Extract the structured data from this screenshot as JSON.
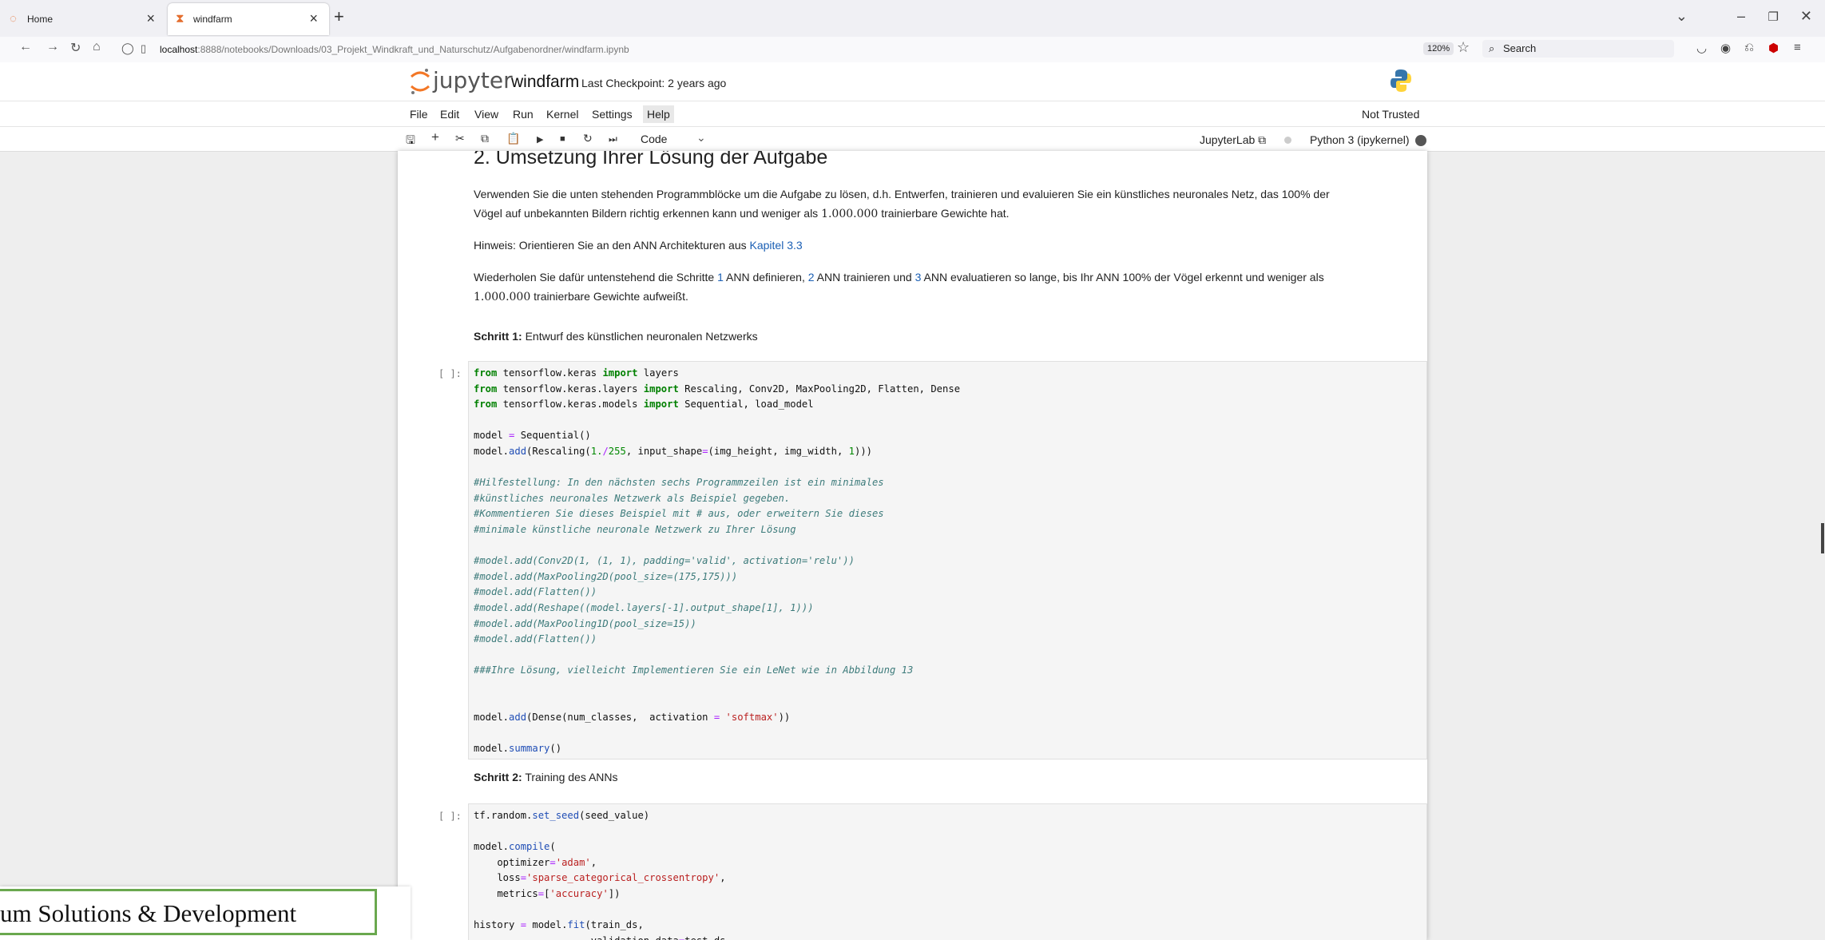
{
  "browser": {
    "tabs": [
      {
        "title": "Home"
      },
      {
        "title": "windfarm"
      }
    ],
    "url_host": "localhost",
    "url_path": ":8888/notebooks/Downloads/03_Projekt_Windkraft_und_Naturschutz/Aufgabenordner/windfarm.ipynb",
    "zoom": "120%",
    "search_placeholder": "Search"
  },
  "jupyter": {
    "logo_text": "jupyter",
    "notebook_name": "windfarm",
    "checkpoint": "Last Checkpoint: 2 years ago",
    "menu": [
      "File",
      "Edit",
      "View",
      "Run",
      "Kernel",
      "Settings",
      "Help"
    ],
    "trust": "Not Trusted",
    "cell_type": "Code",
    "jupyterlab_label": "JupyterLab",
    "kernel_name": "Python 3 (ipykernel)"
  },
  "notebook": {
    "heading": "2. Umsetzung Ihrer Lösung der Aufgabe",
    "p1_line1": "Verwenden Sie die unten stehenden Programmblöcke um die Aufgabe zu lösen, d.h. Entwerfen, trainieren und evaluieren Sie ein künstliches neuronales Netz, das 100% der",
    "p1_line2_a": "Vögel auf unbekannten Bildern richtig erkennen kann und weniger als ",
    "p1_line2_num": "1.000.000",
    "p1_line2_b": " trainierbare Gewichte hat.",
    "hint_a": "Hinweis: Orientieren Sie an den ANN Architekturen aus ",
    "hint_link": "Kapitel 3.3",
    "p3_a": "Wiederholen Sie dafür untenstehend die Schritte ",
    "p3_n1": "1",
    "p3_b": " ANN definieren, ",
    "p3_n2": "2",
    "p3_c": " ANN trainieren und ",
    "p3_n3": "3",
    "p3_d": " ANN evaluatieren so lange, bis Ihr ANN 100% der Vögel erkennt und weniger als",
    "p3_num": "1.000.000",
    "p3_e": " trainierbare Gewichte aufweißt.",
    "step1_bold": "Schritt 1:",
    "step1_text": " Entwurf des künstlichen neuronalen Netzwerks",
    "step2_bold": "Schritt 2:",
    "step2_text": " Training des ANNs",
    "prompt": "[ ]:"
  },
  "overlay": {
    "banner_text": "um Solutions & Development"
  }
}
